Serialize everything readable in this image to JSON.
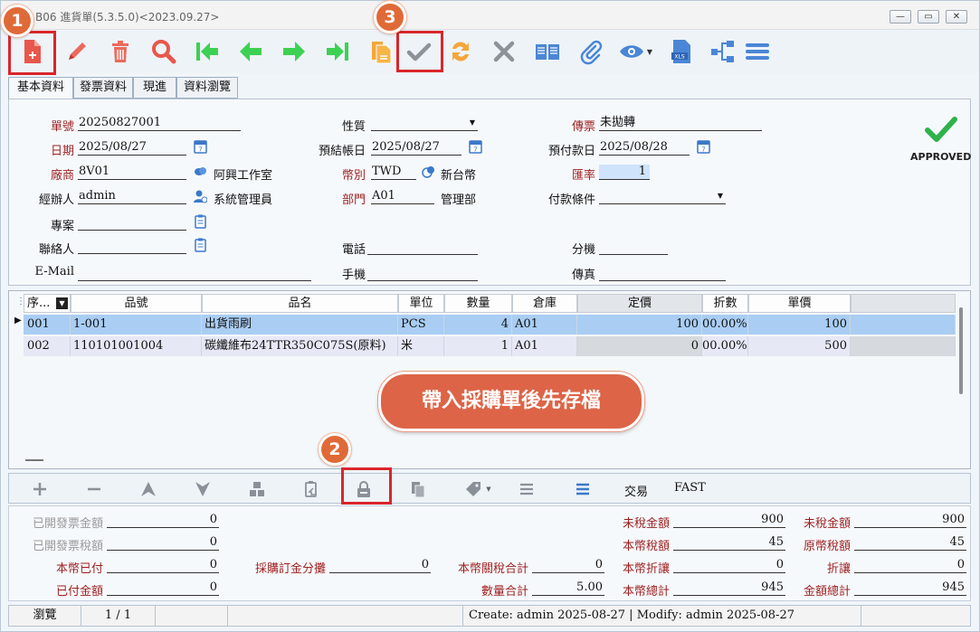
{
  "window": {
    "title": "B06 進貨單(5.3.5.0)<2023.09.27>",
    "minimize": "—",
    "restore": "▭",
    "close": "✕"
  },
  "annotations": {
    "badge1": "1",
    "badge2": "2",
    "badge3": "3",
    "callout": "帶入採購單後先存檔"
  },
  "tabs": [
    "基本資料",
    "發票資料",
    "現進",
    "資料瀏覽"
  ],
  "form": {
    "order_no_label": "單號",
    "order_no": "20250827001",
    "date_label": "日期",
    "date": "2025/08/27",
    "vendor_label": "廠商",
    "vendor_code": "8V01",
    "vendor_name": "阿興工作室",
    "handler_label": "經辦人",
    "handler": "admin",
    "handler_name": "系統管理員",
    "project_label": "專案",
    "project": "",
    "contact_label": "聯絡人",
    "contact": "",
    "email_label": "E-Mail",
    "email": "",
    "nature_label": "性質",
    "nature": "",
    "settle_date_label": "預結帳日",
    "settle_date": "2025/08/27",
    "currency_label": "幣別",
    "currency": "TWD",
    "currency_name": "新台幣",
    "dept_label": "部門",
    "dept": "A01",
    "dept_name": "管理部",
    "phone_label": "電話",
    "phone": "",
    "mobile_label": "手機",
    "mobile": "",
    "voucher_label": "傳票",
    "voucher": "未拋轉",
    "pay_date_label": "預付款日",
    "pay_date": "2025/08/28",
    "rate_label": "匯率",
    "rate": "1",
    "pay_terms_label": "付款條件",
    "pay_terms": "",
    "ext_label": "分機",
    "ext": "",
    "fax_label": "傳真",
    "fax": "",
    "approved": "APPROVED"
  },
  "grid": {
    "headers": [
      "序...",
      "品號",
      "品名",
      "單位",
      "數量",
      "倉庫",
      "定價",
      "折數",
      "單價"
    ],
    "rows": [
      [
        "001",
        "1-001",
        "出貨雨刷",
        "PCS",
        "4",
        "A01",
        "100",
        "00.00%",
        "100"
      ],
      [
        "002",
        "110101001004",
        "碳纖維布24TTR350C075S(原料)",
        "米",
        "1",
        "A01",
        "0",
        "00.00%",
        "500"
      ]
    ]
  },
  "bottom_toolbar": {
    "trade_label": "交易",
    "trade_value": "FAST"
  },
  "summary": {
    "invoiced_amount_label": "已開發票金額",
    "invoiced_amount": "0",
    "invoiced_tax_label": "已開發票稅額",
    "invoiced_tax": "0",
    "paid_local_label": "本幣已付",
    "paid_local": "0",
    "paid_amount_label": "已付金額",
    "paid_amount": "0",
    "po_deposit_label": "採購訂金分攤",
    "po_deposit": "0",
    "customs_tax_label": "本幣關稅合計",
    "customs_tax": "0",
    "qty_total_label": "數量合計",
    "qty_total": "5.00",
    "untaxed_label": "未稅金額",
    "untaxed": "900",
    "local_tax_label": "本幣稅額",
    "local_tax": "45",
    "local_discount_label": "本幣折讓",
    "local_discount": "0",
    "local_total_label": "本幣總計",
    "local_total": "945",
    "untaxed2_label": "未稅金額",
    "untaxed2": "900",
    "orig_tax_label": "原幣稅額",
    "orig_tax": "45",
    "discount_label": "折讓",
    "discount": "0",
    "amount_total_label": "金額總計",
    "amount_total": "945"
  },
  "status": {
    "mode": "瀏覽",
    "page": "1 / 1",
    "info": "Create: admin 2025-08-27 | Modify: admin 2025-08-27"
  }
}
